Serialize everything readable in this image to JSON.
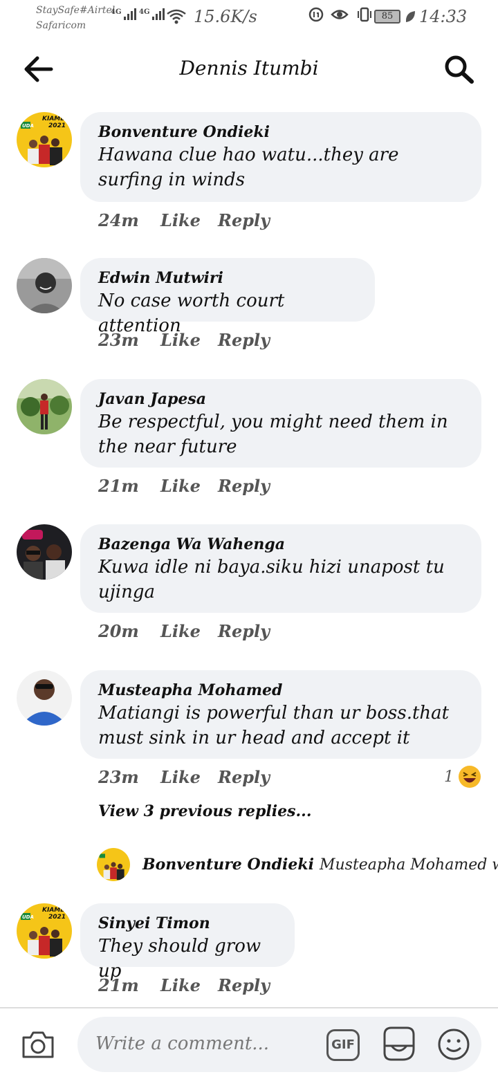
{
  "status_bar": {
    "carrier_1": "StaySafe#Airtel",
    "carrier_2": "Safaricom",
    "network_1": "4G",
    "network_2": "4G",
    "speed": "15.6K/s",
    "battery": "85",
    "time": "14:33"
  },
  "header": {
    "title": "Dennis Itumbi",
    "back_icon": "arrow-left-icon",
    "search_icon": "search-icon"
  },
  "comments": [
    {
      "author": "Bonventure Ondieki",
      "text": "Hawana clue hao watu...they are surfing in winds",
      "time": "24m",
      "like": "Like",
      "reply": "Reply"
    },
    {
      "author": "Edwin Mutwiri",
      "text": "No case worth court attention",
      "time": "23m",
      "like": "Like",
      "reply": "Reply"
    },
    {
      "author": "Javan Japesa",
      "text": "Be respectful, you might need them in the near future",
      "time": "21m",
      "like": "Like",
      "reply": "Reply"
    },
    {
      "author": "Bazenga Wa Wahenga",
      "text": "Kuwa idle ni baya.siku hizi unapost tu ujinga",
      "time": "20m",
      "like": "Like",
      "reply": "Reply"
    },
    {
      "author": "Musteapha Mohamed",
      "text": "Matiangi is powerful than ur boss.that must sink in ur head and accept it",
      "time": "23m",
      "like": "Like",
      "reply": "Reply",
      "reaction_count": "1",
      "reaction_icon": "laughing-emoji-icon"
    },
    {
      "author": "Sinyei Timon",
      "text": "They should grow up",
      "time": "21m",
      "like": "Like",
      "reply": "Reply"
    }
  ],
  "replies": {
    "view_previous": "View 3 previous replies...",
    "preview_author": "Bonventure Ondieki",
    "preview_text": "Musteapha Mohamed w..."
  },
  "avatar_badge": {
    "line1": "KIAMBU",
    "line2": "2021",
    "party": "UDA"
  },
  "composer": {
    "placeholder": "Write a comment...",
    "gif_label": "GIF",
    "camera_icon": "camera-icon",
    "sticker_icon": "sticker-icon",
    "emoji_icon": "smiley-icon"
  },
  "colors": {
    "bubble": "#f0f2f5",
    "text": "#111111",
    "meta": "#555555",
    "badge_yellow": "#f5c518",
    "badge_green": "#1b8a3a"
  }
}
